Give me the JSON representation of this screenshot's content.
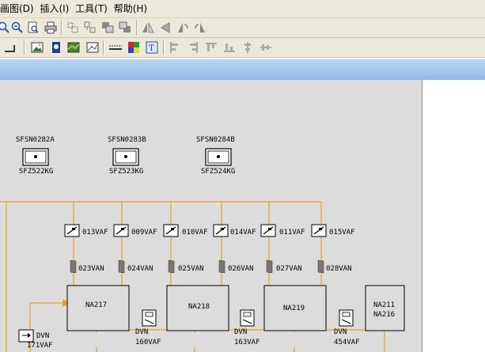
{
  "menu": {
    "items": [
      "画图(D)",
      "插入(I)",
      "工具(T)",
      "帮助(H)"
    ]
  },
  "colors": {
    "pipe": "#e8a21a",
    "canvas_bg": "#dcdcdc",
    "caption_bar": "#a8cbf0"
  },
  "toolbar1": {
    "icons": [
      "zoom-in-icon",
      "zoom-out-icon",
      "print-preview-icon",
      "print-icon",
      "group-icon",
      "ungroup-icon",
      "bring-front-icon",
      "send-back-icon",
      "flip-horizontal-icon",
      "flip-vertical-icon",
      "rotate-left-icon",
      "rotate-right-icon"
    ]
  },
  "toolbar2": {
    "icons": [
      "line-icon",
      "image-icon",
      "picture-icon",
      "chart-icon",
      "scatter-icon",
      "dashed-line-icon",
      "color-palette-icon",
      "text-box-icon",
      "align-left-icon",
      "align-center-icon",
      "align-top-icon",
      "align-bottom-icon",
      "distribute-icon",
      "resize-icon"
    ]
  },
  "diagram": {
    "sources": [
      {
        "top": "SFSN0282A",
        "bottom": "SFZ522KG"
      },
      {
        "top": "SFSN0283B",
        "bottom": "SFZ523KG"
      },
      {
        "top": "SFSN0284B",
        "bottom": "SFZ524KG"
      }
    ],
    "valves_top": [
      "013VAF",
      "009VAF",
      "010VAF",
      "014VAF",
      "011VAF",
      "015VAF"
    ],
    "valves_mid": [
      "023VAN",
      "024VAN",
      "025VAN",
      "026VAN",
      "027VAN",
      "028VAN"
    ],
    "units": [
      "NA217",
      "NA218",
      "NA219"
    ],
    "unit_last": [
      "NA211",
      "NA216"
    ],
    "dvn_valves": [
      {
        "top": "DVN",
        "bottom": "171VAF"
      },
      {
        "top": "DVN",
        "bottom": "160VAF"
      },
      {
        "top": "DVN",
        "bottom": "163VAF"
      },
      {
        "top": "DVN",
        "bottom": "454VAF"
      }
    ]
  }
}
